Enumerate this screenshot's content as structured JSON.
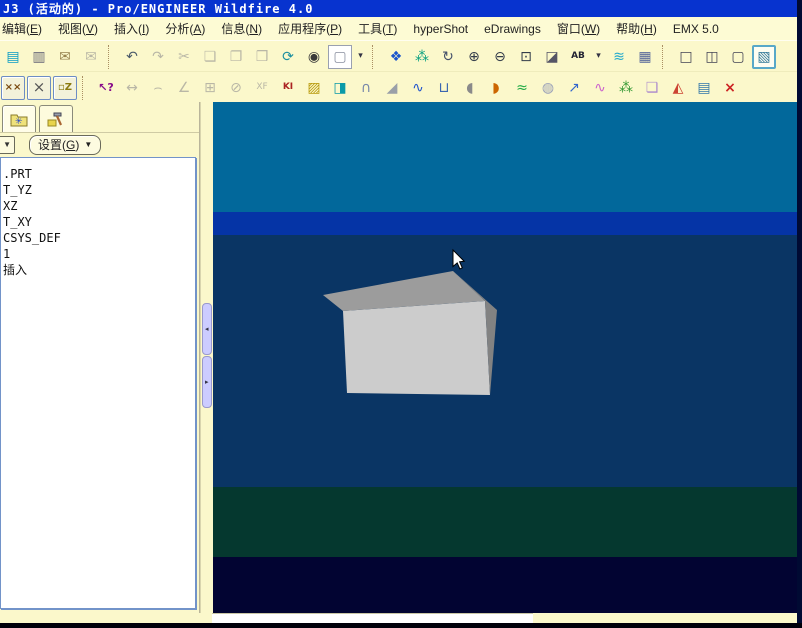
{
  "window": {
    "title": "J3 (活动的) - Pro/ENGINEER Wildfire 4.0"
  },
  "menu": {
    "items": [
      "编辑(E)",
      "视图(V)",
      "插入(I)",
      "分析(A)",
      "信息(N)",
      "应用程序(P)",
      "工具(T)",
      "hyperShot",
      "eDrawings",
      "窗口(W)",
      "帮助(H)",
      "EMX 5.0"
    ]
  },
  "toolbar_main": {
    "items": [
      {
        "n": "save-icon",
        "g": "▤",
        "cls": "btn",
        "s": "color:#0a9cc4",
        "ia": "true"
      },
      {
        "n": "print-icon",
        "g": "▥",
        "cls": "btn",
        "s": "color:#667",
        "ia": "true"
      },
      {
        "n": "print-to-mail-icon",
        "g": "✉",
        "cls": "btn",
        "s": "color:#96824e",
        "ia": "true"
      },
      {
        "n": "send-mail-icon",
        "g": "✉",
        "cls": "btn disabled",
        "ia": "true"
      },
      {
        "n": "separator",
        "g": "",
        "cls": "sep-x",
        "ia": "false"
      },
      {
        "n": "undo-icon",
        "g": "↶",
        "cls": "btn",
        "s": "color:#4a5a6a",
        "ia": "true"
      },
      {
        "n": "redo-icon",
        "g": "↷",
        "cls": "btn disabled",
        "ia": "true"
      },
      {
        "n": "cut-icon",
        "g": "✂",
        "cls": "btn disabled",
        "ia": "true"
      },
      {
        "n": "copy-icon",
        "g": "❏",
        "cls": "btn disabled",
        "ia": "true"
      },
      {
        "n": "paste-icon",
        "g": "❐",
        "cls": "btn disabled",
        "ia": "true"
      },
      {
        "n": "paste-special-icon",
        "g": "❒",
        "cls": "btn disabled",
        "ia": "true"
      },
      {
        "n": "regenerate-icon",
        "g": "⟳",
        "cls": "btn",
        "s": "color:#1d8fa0",
        "ia": "true"
      },
      {
        "n": "find-icon",
        "g": "◉",
        "cls": "btn",
        "s": "color:#3a3a3a",
        "ia": "true"
      },
      {
        "n": "select-box-icon",
        "g": "▢",
        "cls": "btn white",
        "s": "color:#8a90a0",
        "ia": "true"
      },
      {
        "n": "select-dropdown-icon",
        "g": "▾",
        "cls": "btn narrow",
        "s": "color:#334;font-size:9px",
        "ia": "true"
      },
      {
        "n": "separator",
        "g": "",
        "cls": "sep-x",
        "ia": "false"
      },
      {
        "n": "repaint-icon",
        "g": "❖",
        "cls": "btn",
        "s": "color:#1a55cc",
        "ia": "true"
      },
      {
        "n": "orient-mode-icon",
        "g": "⁂",
        "cls": "btn",
        "s": "color:#0aa080",
        "ia": "true"
      },
      {
        "n": "spin-center-icon",
        "g": "↻",
        "cls": "btn",
        "s": "color:#44506a",
        "ia": "true"
      },
      {
        "n": "zoom-in-icon",
        "g": "⊕",
        "cls": "btn",
        "s": "color:#333c4a",
        "ia": "true"
      },
      {
        "n": "zoom-out-icon",
        "g": "⊖",
        "cls": "btn",
        "s": "color:#333c4a",
        "ia": "true"
      },
      {
        "n": "zoom-refit-icon",
        "g": "⊡",
        "cls": "btn",
        "s": "color:#333c4a",
        "ia": "true"
      },
      {
        "n": "reorient-view-icon",
        "g": "◪",
        "cls": "btn",
        "s": "color:#556",
        "ia": "true"
      },
      {
        "n": "saved-views-icon",
        "g": "AB",
        "cls": "btn",
        "s": "color:#223;font-size:9px;font-weight:bold",
        "ia": "true"
      },
      {
        "n": "saved-views-dropdown-icon",
        "g": "▾",
        "cls": "btn narrow",
        "s": "color:#334;font-size:9px",
        "ia": "true"
      },
      {
        "n": "layers-icon",
        "g": "≋",
        "cls": "btn",
        "s": "color:#22aacc",
        "ia": "true"
      },
      {
        "n": "model-tree-toggle-icon",
        "g": "▦",
        "cls": "btn",
        "s": "color:#556699",
        "ia": "true"
      },
      {
        "n": "separator",
        "g": "",
        "cls": "sep-x",
        "ia": "false"
      },
      {
        "n": "wireframe-display-icon",
        "g": "□",
        "cls": "btn",
        "s": "color:#445",
        "ia": "true"
      },
      {
        "n": "hidden-line-display-icon",
        "g": "◫",
        "cls": "btn",
        "s": "color:#445",
        "ia": "true"
      },
      {
        "n": "no-hidden-display-icon",
        "g": "▢",
        "cls": "btn",
        "s": "color:#445",
        "ia": "true"
      },
      {
        "n": "shaded-display-icon",
        "g": "▧",
        "cls": "btn active",
        "s": "color:#357a9a",
        "ia": "true"
      }
    ]
  },
  "toolbar_analysis": {
    "items": [
      {
        "n": "datum-point-display-icon",
        "g": "××",
        "cls": "btn toggled",
        "s": "color:#7a4a10;font-size:10px;font-weight:bold",
        "ia": "true"
      },
      {
        "n": "datum-axis-display-icon",
        "g": "×",
        "cls": "btn toggled",
        "s": "color:#555;font-size:15px",
        "ia": "true"
      },
      {
        "n": "csys-display-icon",
        "g": "▫Z",
        "cls": "btn toggled",
        "s": "color:#8a7a10;font-size:10px;font-weight:bold",
        "ia": "true"
      },
      {
        "n": "separator",
        "g": "",
        "cls": "sep-x",
        "ia": "false"
      },
      {
        "n": "context-help-icon",
        "g": "↖?",
        "cls": "btn",
        "s": "color:#880b8a;font-size:11px;font-weight:bold",
        "ia": "true"
      },
      {
        "n": "measure-distance-icon",
        "g": "↔",
        "cls": "btn disabled",
        "ia": "true"
      },
      {
        "n": "measure-length-icon",
        "g": "⌢",
        "cls": "btn disabled",
        "ia": "true"
      },
      {
        "n": "measure-angle-icon",
        "g": "∠",
        "cls": "btn disabled",
        "ia": "true"
      },
      {
        "n": "measure-dimension-icon",
        "g": "⊞",
        "cls": "btn disabled",
        "ia": "true"
      },
      {
        "n": "measure-diameter-icon",
        "g": "⊘",
        "cls": "btn disabled",
        "ia": "true"
      },
      {
        "n": "measure-transform-icon",
        "g": "XF",
        "cls": "btn disabled",
        "s": "font-size:9px",
        "ia": "true"
      },
      {
        "n": "mass-properties-icon",
        "g": "KI",
        "cls": "btn",
        "s": "color:#aa2222;font-size:9px;font-weight:bold",
        "ia": "true"
      },
      {
        "n": "section-analysis-icon",
        "g": "▨",
        "cls": "btn",
        "s": "color:#b89a0a",
        "ia": "true"
      },
      {
        "n": "volume-analysis-icon",
        "g": "◨",
        "cls": "btn",
        "s": "color:#0a9aa8",
        "ia": "true"
      },
      {
        "n": "pipe-analysis-icon",
        "g": "∩",
        "cls": "btn",
        "s": "color:#7788aa",
        "ia": "true"
      },
      {
        "n": "draft-analysis-icon",
        "g": "◢",
        "cls": "btn",
        "s": "color:#9aa0a8",
        "ia": "true"
      },
      {
        "n": "curve-analysis-icon",
        "g": "∿",
        "cls": "btn",
        "s": "color:#2255cc",
        "ia": "true"
      },
      {
        "n": "surface-analysis-icon",
        "g": "⊔",
        "cls": "btn",
        "s": "color:#3a66b0",
        "ia": "true"
      },
      {
        "n": "shaded-curvature-icon",
        "g": "◖",
        "cls": "btn",
        "s": "color:#8a8a8a",
        "ia": "true"
      },
      {
        "n": "color-map-icon",
        "g": "◗",
        "cls": "btn",
        "s": "color:#cc6600",
        "ia": "true"
      },
      {
        "n": "dihedral-angle-icon",
        "g": "≈",
        "cls": "btn",
        "s": "color:#22aa44",
        "ia": "true"
      },
      {
        "n": "reflection-analysis-icon",
        "g": "◍",
        "cls": "btn",
        "s": "color:#99a0b8",
        "ia": "true"
      },
      {
        "n": "normal-analysis-icon",
        "g": "↗",
        "cls": "btn",
        "s": "color:#3366cc",
        "ia": "true"
      },
      {
        "n": "curvature-plot-icon",
        "g": "∿",
        "cls": "btn",
        "s": "color:#cc66cc",
        "ia": "true"
      },
      {
        "n": "mesh-analysis-icon",
        "g": "⁂",
        "cls": "btn",
        "s": "color:#339933",
        "ia": "true"
      },
      {
        "n": "offset-planes-icon",
        "g": "❏",
        "cls": "btn",
        "s": "color:#aa88cc",
        "ia": "true"
      },
      {
        "n": "color-fan-icon",
        "g": "◭",
        "cls": "btn",
        "s": "color:#cc4433",
        "ia": "true"
      },
      {
        "n": "saved-analyses-icon",
        "g": "▤",
        "cls": "btn",
        "s": "color:#3377aa",
        "ia": "true"
      },
      {
        "n": "delete-all-analyses-icon",
        "g": "×",
        "cls": "btn",
        "s": "color:#cc2222;font-weight:bold",
        "ia": "true"
      }
    ]
  },
  "navigator": {
    "settings_label": "设置(G)",
    "settings_arrow": "▼",
    "combo_arrow": "▼",
    "tree_items": [
      ".PRT",
      "T_YZ",
      "XZ",
      "T_XY",
      "CSYS_DEF",
      "1",
      "插入"
    ]
  },
  "sash": {
    "collapse_arrow": "◂",
    "expand_arrow": "▸"
  },
  "viewport": {
    "bands": [
      {
        "name": "sky-band",
        "css": "height:110px;background:#02689B"
      },
      {
        "name": "horizon-band",
        "css": "height:23px;background:#0534A6"
      },
      {
        "name": "water-band",
        "css": "height:252px;background:#0A3564"
      },
      {
        "name": "ground-band",
        "css": "height:70px;background:#05382F"
      },
      {
        "name": "base-band",
        "css": "height:56px;background:#020432"
      }
    ],
    "box": {
      "top_color": "#9c9c9c",
      "front_color": "#cccccc",
      "side_color": "#828282"
    }
  },
  "statusbar": {
    "message": ""
  },
  "colors": {
    "titlebar": "#0733CF",
    "panel_bg": "#FBF8CB",
    "tree_bg": "#ffffff",
    "sash_button": "#ccccff"
  }
}
